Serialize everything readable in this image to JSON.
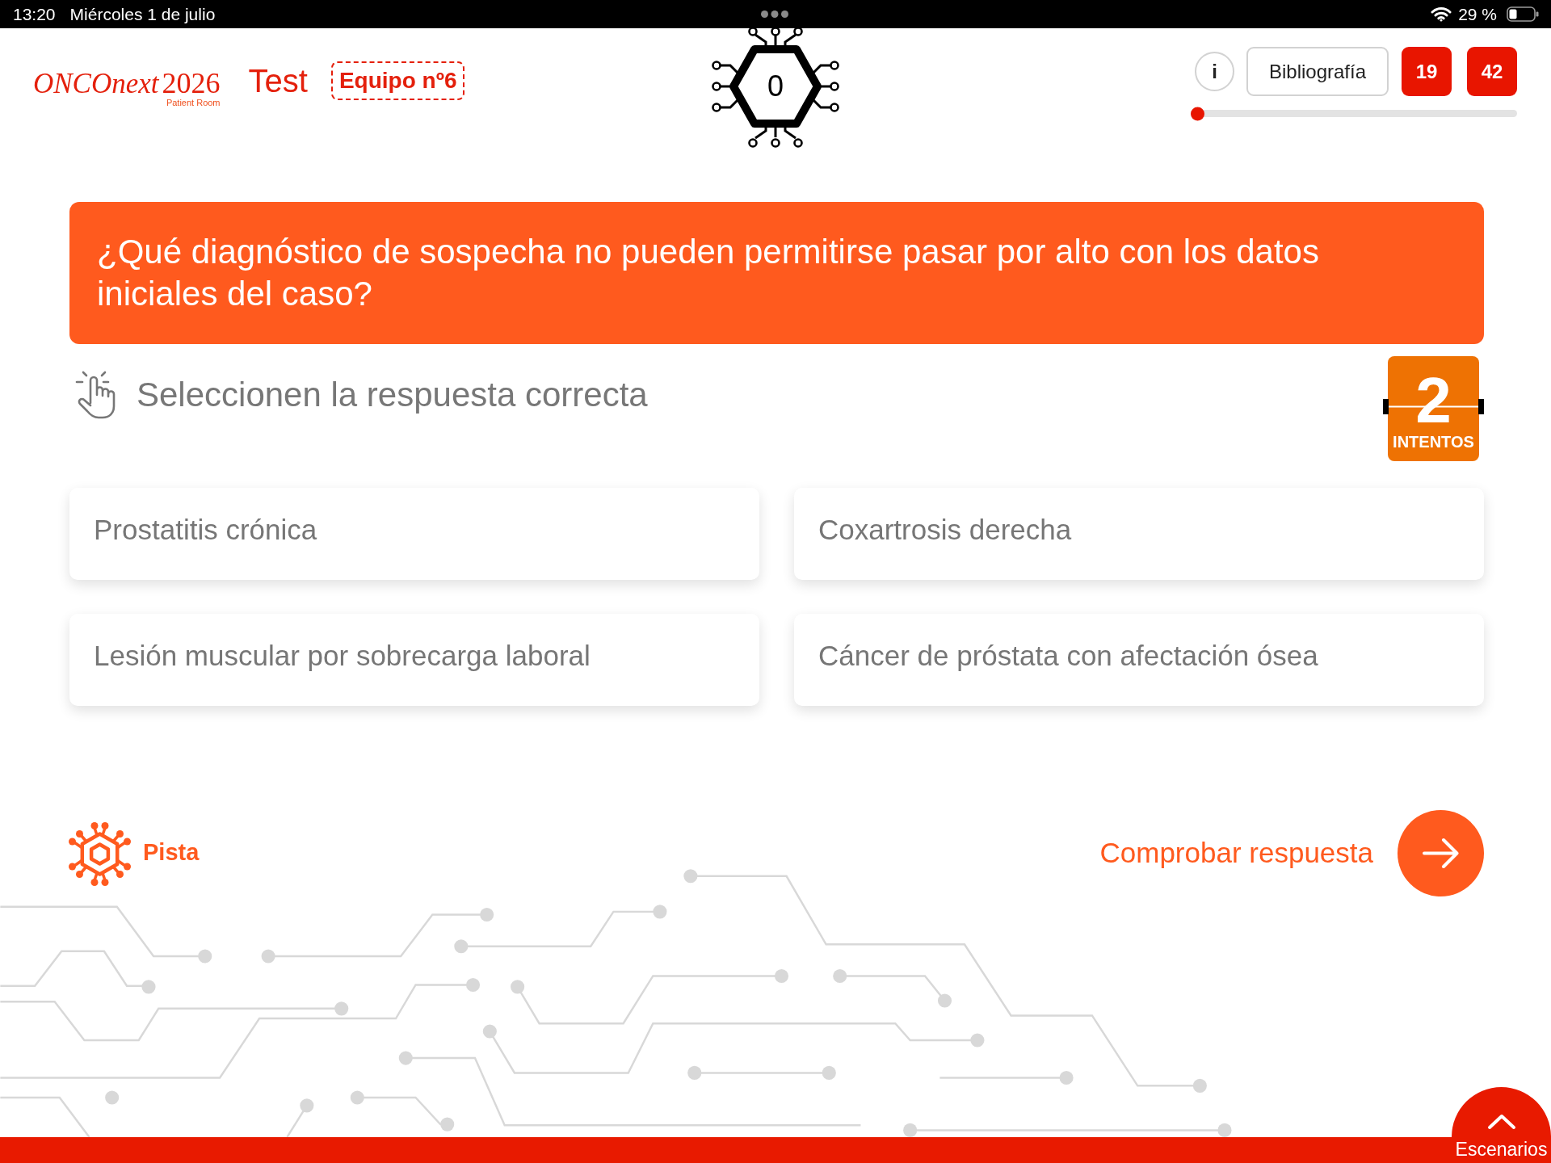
{
  "status_bar": {
    "time": "13:20",
    "date": "Miércoles 1 de julio",
    "battery_text": "29 %"
  },
  "header": {
    "logo": {
      "brand": "ONCOnext",
      "year": "2026",
      "subtitle": "Patient Room"
    },
    "mode": "Test",
    "team": "Equipo nº6",
    "score": "0",
    "info_button": "i",
    "bibliography_button": "Bibliografía",
    "counters": [
      "19",
      "42"
    ],
    "progress": {
      "level": 0
    }
  },
  "question": {
    "text": "¿Qué diagnóstico de sospecha no pueden permitirse pasar por alto con los datos iniciales del caso?",
    "instruction": "Seleccionen la respuesta correcta",
    "attempts": {
      "count": "2",
      "label": "INTENTOS"
    },
    "options": [
      {
        "label": "Prostatitis crónica",
        "selected": false
      },
      {
        "label": "Coxartrosis derecha",
        "selected": false
      },
      {
        "label": "Lesión muscular por sobrecarga laboral",
        "selected": false
      },
      {
        "label": "Cáncer de próstata con afectación ósea",
        "selected": false
      }
    ]
  },
  "footer": {
    "hint_button": "Pista",
    "check_button": "Comprobar respuesta",
    "scenarios_button": "Escenarios"
  }
}
